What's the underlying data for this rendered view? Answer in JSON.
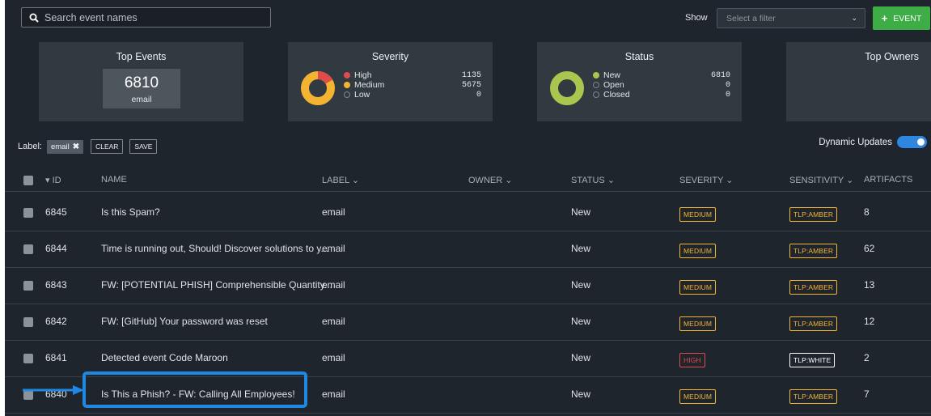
{
  "search": {
    "placeholder": "Search event names"
  },
  "filter": {
    "label": "Show",
    "placeholder": "Select a filter"
  },
  "event_button": {
    "label": "EVENT"
  },
  "cards": {
    "top_events": {
      "title": "Top Events",
      "count": "6810",
      "name": "email"
    },
    "severity": {
      "title": "Severity",
      "items": [
        {
          "label": "High",
          "value": "1135",
          "color": "#e04b4b"
        },
        {
          "label": "Medium",
          "value": "5675",
          "color": "#f4b431"
        },
        {
          "label": "Low",
          "value": "0",
          "color": ""
        }
      ]
    },
    "status": {
      "title": "Status",
      "items": [
        {
          "label": "New",
          "value": "6810",
          "color": "#a9c74e"
        },
        {
          "label": "Open",
          "value": "0",
          "color": ""
        },
        {
          "label": "Closed",
          "value": "0",
          "color": ""
        }
      ]
    },
    "top_owners": {
      "title": "Top Owners"
    }
  },
  "label_bar": {
    "label": "Label:",
    "chip": "email",
    "chip_remove": "✖",
    "clear": "CLEAR",
    "save": "SAVE"
  },
  "dynamic_updates": {
    "label": "Dynamic Updates",
    "on": true
  },
  "table": {
    "headers": {
      "id": "▾ ID",
      "name": "NAME",
      "label": "LABEL ⌄",
      "owner": "OWNER ⌄",
      "status": "STATUS ⌄",
      "severity": "SEVERITY ⌄",
      "sensitivity": "SENSITIVITY ⌄",
      "artifacts": "ARTIFACTS"
    },
    "rows": [
      {
        "id": "6845",
        "name": "Is this Spam?",
        "label": "email",
        "owner": "",
        "status": "New",
        "severity": "MEDIUM",
        "sensitivity": "TLP:AMBER",
        "artifacts": "8"
      },
      {
        "id": "6844",
        "name": "Time is running out, Should! Discover solutions to y...",
        "label": "email",
        "owner": "",
        "status": "New",
        "severity": "MEDIUM",
        "sensitivity": "TLP:AMBER",
        "artifacts": "62"
      },
      {
        "id": "6843",
        "name": "FW: [POTENTIAL PHISH] Comprehensible Quantity...",
        "label": "email",
        "owner": "",
        "status": "New",
        "severity": "MEDIUM",
        "sensitivity": "TLP:AMBER",
        "artifacts": "13"
      },
      {
        "id": "6842",
        "name": "FW: [GitHub] Your password was reset",
        "label": "email",
        "owner": "",
        "status": "New",
        "severity": "MEDIUM",
        "sensitivity": "TLP:AMBER",
        "artifacts": "12"
      },
      {
        "id": "6841",
        "name": "Detected event Code Maroon",
        "label": "email",
        "owner": "",
        "status": "New",
        "severity": "HIGH",
        "sensitivity": "TLP:WHITE",
        "artifacts": "2"
      },
      {
        "id": "6840",
        "name": "Is This a Phish? - FW: Calling All Employees!",
        "label": "email",
        "owner": "",
        "status": "New",
        "severity": "MEDIUM",
        "sensitivity": "TLP:AMBER",
        "artifacts": "7"
      }
    ]
  },
  "annotation": {
    "highlight_color": "#1e88e5",
    "highlighted_row_id": "6840"
  }
}
